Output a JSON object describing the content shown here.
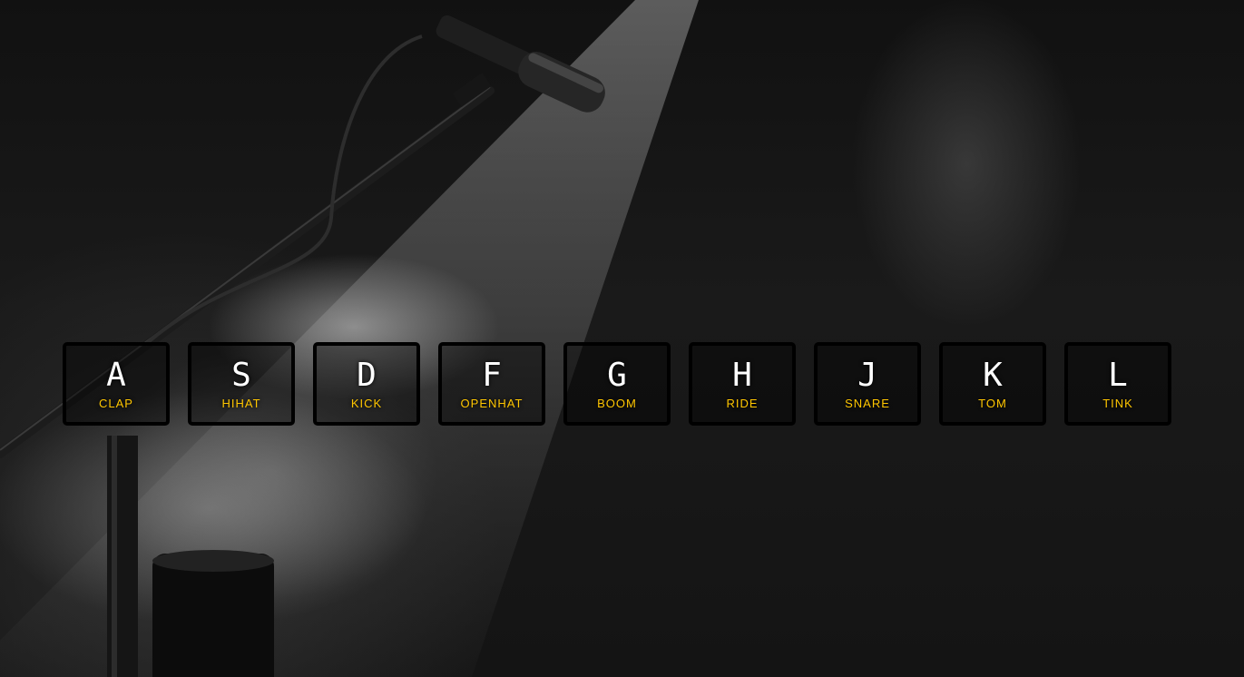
{
  "keys": [
    {
      "letter": "A",
      "sound": "CLAP"
    },
    {
      "letter": "S",
      "sound": "HIHAT"
    },
    {
      "letter": "D",
      "sound": "KICK"
    },
    {
      "letter": "F",
      "sound": "OPENHAT"
    },
    {
      "letter": "G",
      "sound": "BOOM"
    },
    {
      "letter": "H",
      "sound": "RIDE"
    },
    {
      "letter": "J",
      "sound": "SNARE"
    },
    {
      "letter": "K",
      "sound": "TOM"
    },
    {
      "letter": "L",
      "sound": "TINK"
    }
  ],
  "colors": {
    "letter": "#ffffff",
    "sound": "#ffc600",
    "key_border": "#000000"
  }
}
